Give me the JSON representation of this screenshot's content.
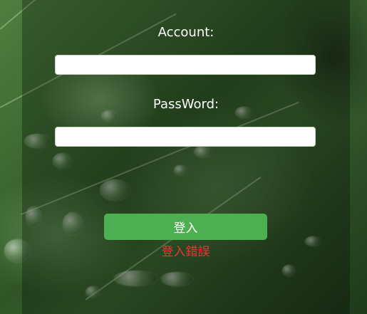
{
  "form": {
    "account_label": "Account:",
    "account_value": "",
    "password_label": "PassWord:",
    "password_value": "",
    "login_button_label": "登入",
    "error_message": "登入錯誤"
  },
  "colors": {
    "button": "#4caf50",
    "error": "#e53935",
    "label": "#ffffff"
  }
}
